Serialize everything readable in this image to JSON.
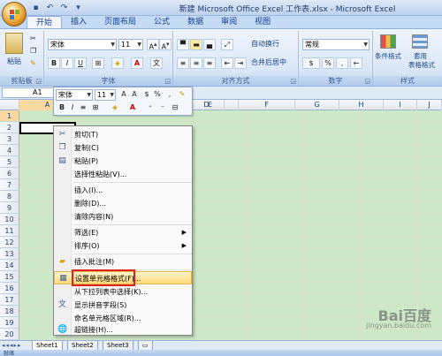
{
  "window": {
    "title": "新建 Microsoft Office Excel 工作表.xlsx - Microsoft Excel"
  },
  "tabs": [
    "开始",
    "插入",
    "页面布局",
    "公式",
    "数据",
    "审阅",
    "视图"
  ],
  "ribbon": {
    "clipboard": {
      "label": "剪贴板",
      "paste": "粘贴"
    },
    "font": {
      "label": "字体",
      "name": "宋体",
      "size": "11"
    },
    "alignment": {
      "label": "对齐方式",
      "wrap": "自动换行",
      "merge": "合并后居中"
    },
    "number": {
      "label": "数字",
      "format": "常规",
      "percent": "%"
    },
    "styles": {
      "label": "样式",
      "conditional": "条件格式",
      "table1": "套用",
      "table2": "表格格式"
    }
  },
  "formula_bar": {
    "name_box": "A1"
  },
  "mini_toolbar": {
    "font": "宋体",
    "size": "11"
  },
  "columns": [
    "A",
    "B",
    "C",
    "D",
    "E",
    "F",
    "G",
    "H",
    "I",
    "J"
  ],
  "rows": [
    "1",
    "2",
    "3",
    "4",
    "5",
    "6",
    "7",
    "8",
    "9",
    "10",
    "11",
    "12",
    "13",
    "14",
    "15",
    "16",
    "17",
    "18",
    "19",
    "20"
  ],
  "context_menu": {
    "items": [
      {
        "label": "剪切(T)",
        "icon": "scissors-icon"
      },
      {
        "label": "复制(C)",
        "icon": "copy-icon"
      },
      {
        "label": "粘贴(P)",
        "icon": "paste-icon"
      },
      {
        "label": "选择性粘贴(V)...",
        "icon": ""
      },
      {
        "label": "插入(I)...",
        "icon": ""
      },
      {
        "label": "删除(D)...",
        "icon": ""
      },
      {
        "label": "清除内容(N)",
        "icon": ""
      },
      {
        "label": "筛选(E)",
        "icon": ""
      },
      {
        "label": "排序(O)",
        "icon": ""
      },
      {
        "label": "插入批注(M)",
        "icon": "comment-icon"
      },
      {
        "label": "设置单元格格式(F)...",
        "icon": "format-cells-icon"
      },
      {
        "label": "从下拉列表中选择(K)...",
        "icon": ""
      },
      {
        "label": "显示拼音字段(S)",
        "icon": "phonetic-icon"
      },
      {
        "label": "命名单元格区域(R)...",
        "icon": ""
      },
      {
        "label": "超链接(H)...",
        "icon": "hyperlink-icon"
      }
    ]
  },
  "sheets": [
    "Sheet1",
    "Sheet2",
    "Sheet3"
  ],
  "status": {
    "text": "就绪"
  },
  "watermark": {
    "brand": "Bai百度",
    "site": "jingyan.baidu.com"
  }
}
